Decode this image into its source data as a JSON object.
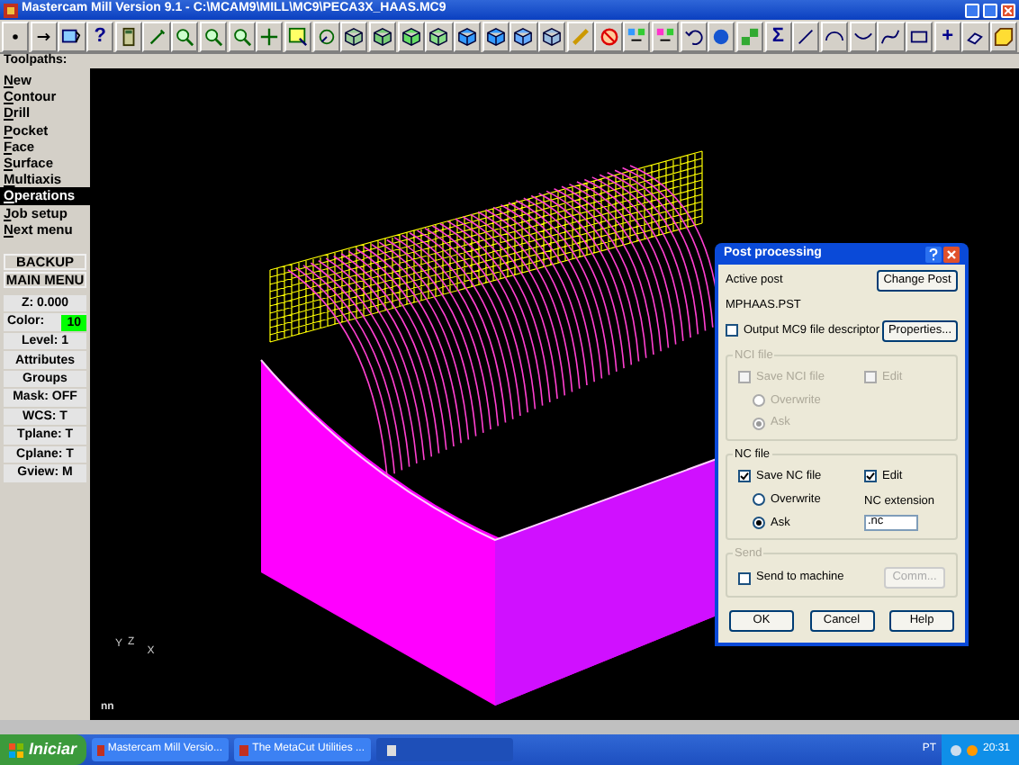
{
  "window": {
    "title": "Mastercam Mill Version 9.1 - C:\\MCAM9\\MILL\\MC9\\PECA3X_HAAS.MC9"
  },
  "toolbar_glyphs": [
    "?",
    "Σ",
    "+"
  ],
  "prompt": "Toolpaths:",
  "menu": {
    "items": [
      {
        "label": "New",
        "selected": false
      },
      {
        "label": "Contour",
        "selected": false
      },
      {
        "label": "Drill",
        "selected": false
      },
      {
        "label": "Pocket",
        "selected": false
      },
      {
        "label": "Face",
        "selected": false
      },
      {
        "label": "Surface",
        "selected": false
      },
      {
        "label": "Multiaxis",
        "selected": false
      },
      {
        "label": "Operations",
        "selected": true
      },
      {
        "label": "Job setup",
        "selected": false
      },
      {
        "label": "Next menu",
        "selected": false
      }
    ],
    "buttons": [
      "BACKUP",
      "MAIN MENU"
    ]
  },
  "status_fields": [
    {
      "kind": "pair",
      "label": "Z:",
      "value": "0.000"
    },
    {
      "kind": "color",
      "label": "Color:",
      "value": "10"
    },
    {
      "kind": "pair",
      "label": "Level:",
      "value": "1"
    },
    {
      "kind": "button",
      "label": "Attributes"
    },
    {
      "kind": "button",
      "label": "Groups"
    },
    {
      "kind": "pair",
      "label": "Mask:",
      "value": "OFF"
    },
    {
      "kind": "pair",
      "label": "WCS:",
      "value": "T"
    },
    {
      "kind": "pair",
      "label": "Tplane:",
      "value": "T"
    },
    {
      "kind": "pair",
      "label": "Cplane:",
      "value": "T"
    },
    {
      "kind": "pair",
      "label": "Gview:",
      "value": "M"
    }
  ],
  "viewport": {
    "axis_labels": [
      "Y",
      "Z",
      "X"
    ],
    "indicator": "nn"
  },
  "dialog": {
    "title": "Post processing",
    "active_post_label": "Active post",
    "change_post": "Change Post",
    "post_file": "MPHAAS.PST",
    "output_descriptor": {
      "label": "Output MC9 file descriptor",
      "checked": false
    },
    "properties": "Properties...",
    "groups": [
      {
        "title": "NCI file",
        "disabled": true,
        "save": {
          "label": "Save NCI file",
          "checked": false
        },
        "edit": {
          "label": "Edit",
          "checked": false
        },
        "options": [
          {
            "label": "Overwrite",
            "selected": false
          },
          {
            "label": "Ask",
            "selected": true
          }
        ]
      },
      {
        "title": "NC file",
        "disabled": false,
        "save": {
          "label": "Save NC file",
          "checked": true
        },
        "edit": {
          "label": "Edit",
          "checked": true
        },
        "options": [
          {
            "label": "Overwrite",
            "selected": false
          },
          {
            "label": "Ask",
            "selected": true
          }
        ],
        "extension_label": "NC extension",
        "extension": ".nc"
      }
    ],
    "send": {
      "title": "Send",
      "disabled": true,
      "checkbox": {
        "label": "Send to machine",
        "checked": false
      },
      "button": "Comm..."
    },
    "buttons": [
      "OK",
      "Cancel",
      "Help"
    ]
  },
  "taskbar": {
    "start": "Iniciar",
    "tasks": [
      {
        "kind": "text",
        "label": "Mastercam Mill Versio..."
      },
      {
        "kind": "text",
        "label": "The MetaCut Utilities ..."
      },
      {
        "kind": "icon"
      }
    ],
    "language": "PT",
    "clock": "20:31"
  }
}
